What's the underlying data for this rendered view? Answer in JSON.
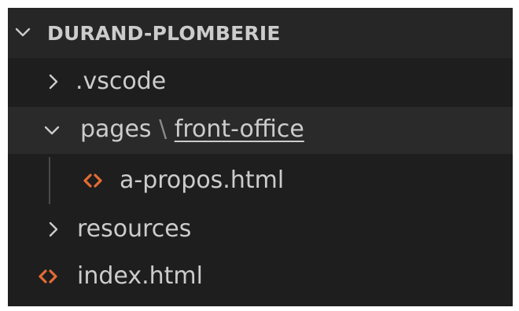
{
  "explorer": {
    "root": {
      "label": "DURAND-PLOMBERIE",
      "expanded": true
    },
    "items": [
      {
        "label": ".vscode",
        "type": "folder",
        "expanded": false
      },
      {
        "label": "pages",
        "separator": "\\",
        "compact_child": "front-office",
        "type": "folder",
        "expanded": true
      },
      {
        "label": "a-propos.html",
        "type": "file",
        "icon": "html-icon"
      },
      {
        "label": "resources",
        "type": "folder",
        "expanded": false
      },
      {
        "label": "index.html",
        "type": "file",
        "icon": "html-icon"
      }
    ]
  },
  "colors": {
    "background": "#1e1e1e",
    "root_header": "#262626",
    "selected_row": "#2a2a2a",
    "text": "#cccccc",
    "html_icon": "#e36c32"
  }
}
